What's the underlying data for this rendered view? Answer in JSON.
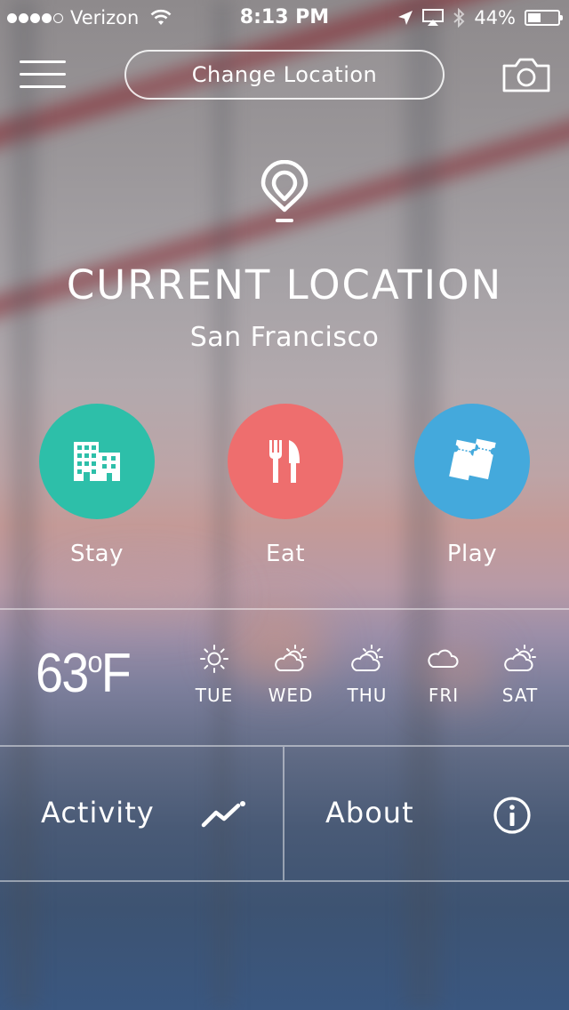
{
  "status_bar": {
    "carrier": "Verizon",
    "signal_bars_filled": 4,
    "signal_bars_total": 5,
    "time": "8:13 PM",
    "battery": "44%",
    "battery_level": 0.44,
    "icons": [
      "wifi-icon",
      "location-arrow-icon",
      "airplay-icon",
      "bluetooth-icon",
      "battery-icon"
    ]
  },
  "header": {
    "menu_icon": "hamburger-menu-icon",
    "change_location_label": "Change Location",
    "camera_icon": "camera-icon"
  },
  "location": {
    "pin_icon": "location-pin-icon",
    "title": "CURRENT LOCATION",
    "city": "San Francisco"
  },
  "categories": [
    {
      "label": "Stay",
      "icon": "hotel-building-icon",
      "color": "#2dbfa9"
    },
    {
      "label": "Eat",
      "icon": "fork-knife-icon",
      "color": "#ee6e6e"
    },
    {
      "label": "Play",
      "icon": "tickets-icon",
      "color": "#44a9dc"
    }
  ],
  "weather": {
    "temperature": "63",
    "unit": "o",
    "unit_letter": "F",
    "forecast": [
      {
        "day": "TUE",
        "icon": "sun-icon"
      },
      {
        "day": "WED",
        "icon": "partly-cloudy-icon"
      },
      {
        "day": "THU",
        "icon": "partly-cloudy-icon"
      },
      {
        "day": "FRI",
        "icon": "cloud-icon"
      },
      {
        "day": "SAT",
        "icon": "partly-cloudy-icon"
      }
    ]
  },
  "bottom": {
    "activity_label": "Activity",
    "activity_icon": "activity-trend-icon",
    "about_label": "About",
    "about_icon": "info-icon"
  }
}
